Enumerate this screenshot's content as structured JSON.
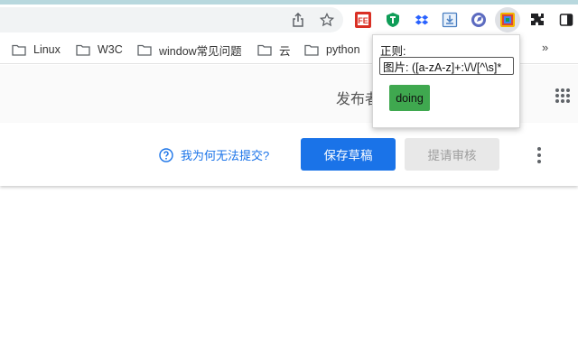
{
  "bookmarks": {
    "items": [
      {
        "label": "Linux"
      },
      {
        "label": "W3C"
      },
      {
        "label": "window常见问题"
      },
      {
        "label": "云"
      },
      {
        "label": "python"
      }
    ],
    "more": "»"
  },
  "page": {
    "publisher_label": "发布者",
    "help_link": "我为何无法提交?",
    "save_draft": "保存草稿",
    "submit_review": "提请审核"
  },
  "popup": {
    "label": "正则:",
    "regex_value": "图片: ([a-zA-z]+:\\/\\/[^\\s]*",
    "action_button": "doing"
  },
  "extensions": {
    "fe_badge": "FE"
  },
  "colors": {
    "primary_blue": "#1a73e8",
    "doing_green": "#3fa84f",
    "top_strip": "#b8d8de"
  },
  "icons": [
    "share-icon",
    "star-icon",
    "fe-extension-icon",
    "shield-extension-icon",
    "dropbox-icon",
    "download-extension-icon",
    "compass-extension-icon",
    "regex-extension-icon",
    "puzzle-icon",
    "sidepanel-icon",
    "folder-icon",
    "help-icon",
    "apps-grid-icon",
    "more-vert-icon"
  ]
}
